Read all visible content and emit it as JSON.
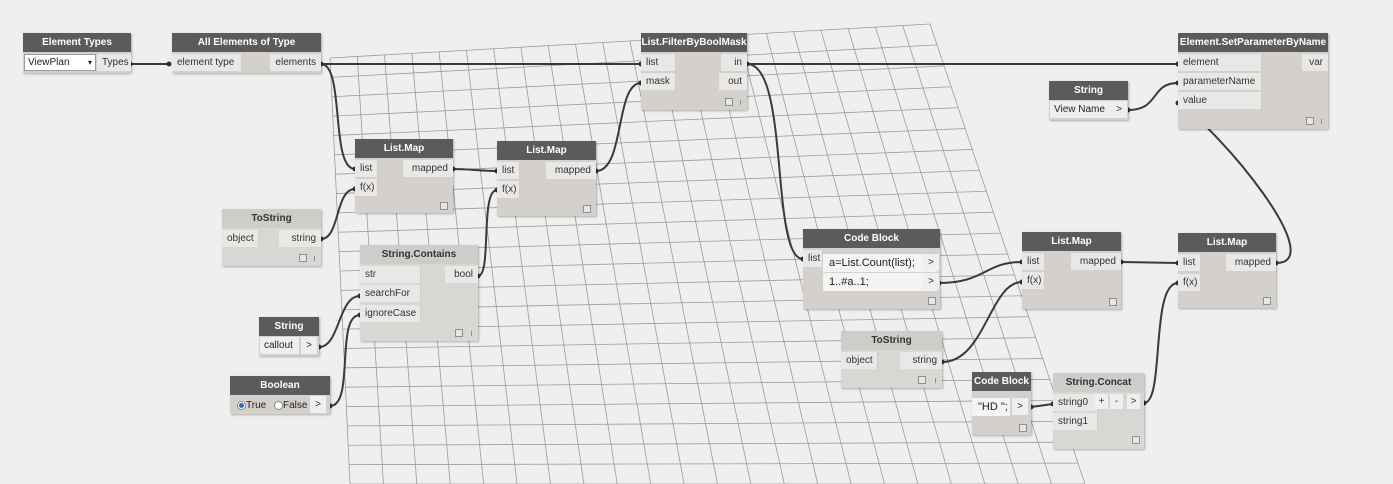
{
  "nodes": {
    "element_types": {
      "title": "Element Types",
      "dropdown_value": "ViewPlan",
      "output": "Types"
    },
    "all_elements_of_type": {
      "title": "All Elements of Type",
      "input": "element type",
      "output": "elements"
    },
    "list_filter_by_bool_mask": {
      "title": "List.FilterByBoolMask",
      "inputs": [
        "list",
        "mask"
      ],
      "outputs": [
        "in",
        "out"
      ]
    },
    "element_set_parameter_by_name": {
      "title": "Element.SetParameterByName",
      "inputs": [
        "element",
        "parameterName",
        "value"
      ],
      "output": "var"
    },
    "string_view_name": {
      "title": "String",
      "value": "View Name",
      "arrow": ">"
    },
    "list_map_1": {
      "title": "List.Map",
      "inputs": [
        "list",
        "f(x)"
      ],
      "output": "mapped"
    },
    "list_map_2": {
      "title": "List.Map",
      "inputs": [
        "list",
        "f(x)"
      ],
      "output": "mapped"
    },
    "tostring_1": {
      "title": "ToString",
      "input": "object",
      "output": "string"
    },
    "string_contains": {
      "title": "String.Contains",
      "inputs": [
        "str",
        "searchFor",
        "ignoreCase"
      ],
      "output": "bool"
    },
    "string_callout": {
      "title": "String",
      "value": "callout",
      "arrow": ">"
    },
    "boolean": {
      "title": "Boolean",
      "true_label": "True",
      "false_label": "False",
      "arrow": ">"
    },
    "code_block_1": {
      "title": "Code Block",
      "input": "list",
      "lines": [
        "a=List.Count(list);",
        "1..#a..1;"
      ],
      "outputs": [
        ">",
        ">"
      ]
    },
    "list_map_3": {
      "title": "List.Map",
      "inputs": [
        "list",
        "f(x)"
      ],
      "output": "mapped"
    },
    "list_map_4": {
      "title": "List.Map",
      "inputs": [
        "list",
        "f(x)"
      ],
      "output": "mapped"
    },
    "tostring_2": {
      "title": "ToString",
      "input": "object",
      "output": "string"
    },
    "code_block_2": {
      "title": "Code Block",
      "line": "\"HD \";",
      "output": ">"
    },
    "string_concat": {
      "title": "String.Concat",
      "inputs": [
        "string0",
        "string1"
      ],
      "add_button": "+",
      "remove_button": "-",
      "output": ">"
    }
  },
  "colors": {
    "canvas_background": "#efefef",
    "node_header": "#5b5b5b",
    "node_header_text": "#ffffff",
    "node_body": "#d4d1cc",
    "port_background": "#e9e8e6",
    "wire": "#3a3a3a",
    "background_preview_grid": "#9c9c9c"
  },
  "icons": {
    "preview_toggle": "square-pin-icon",
    "radio_selected": "radio-selected-icon",
    "radio_unselected": "radio-empty-icon",
    "dropdown_caret": "caret-down-icon"
  }
}
